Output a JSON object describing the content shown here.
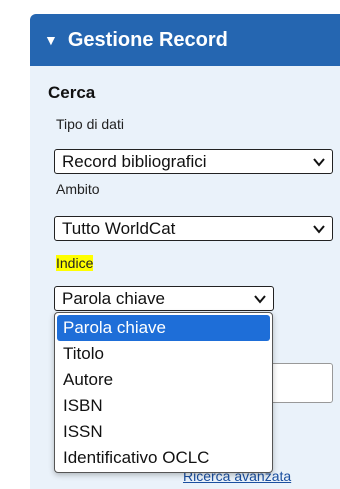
{
  "panel": {
    "title": "Gestione Record",
    "caret_icon": "caret-down-icon"
  },
  "search": {
    "section_title": "Cerca",
    "data_type": {
      "label": "Tipo di dati",
      "value": "Record bibliografici"
    },
    "scope": {
      "label": "Ambito",
      "value": "Tutto WorldCat"
    },
    "index": {
      "label": "Indice",
      "value": "Parola chiave",
      "options": [
        "Parola chiave",
        "Titolo",
        "Autore",
        "ISBN",
        "ISSN",
        "Identificativo OCLC"
      ],
      "selected_option": "Parola chiave"
    },
    "advanced_link": "Ricerca avanzata"
  },
  "colors": {
    "header_bg": "#2566b1",
    "panel_bg": "#eaf2fa",
    "highlight": "#ffff00",
    "selected_option_bg": "#1e6ed8"
  }
}
